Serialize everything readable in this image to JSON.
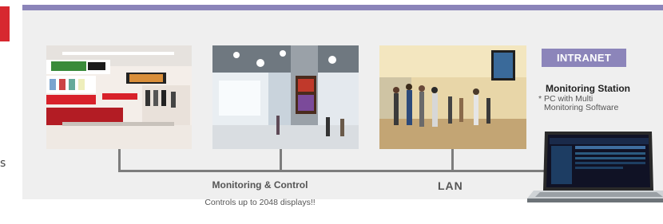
{
  "left_fragment": {
    "text": "s"
  },
  "intranet_label": "INTRANET",
  "monitoring_station": {
    "title": "Monitoring Station",
    "note_line1": "* PC with Multi",
    "note_line2": "Monitoring Software"
  },
  "network": {
    "lan_label": "LAN",
    "control_title": "Monitoring & Control",
    "control_subtitle": "Controls up to 2048 displays!!"
  },
  "colors": {
    "header_bar": "#8b84b9",
    "intranet_badge": "#8c85ba",
    "brand_red": "#d7282f",
    "wire": "#7d7d7d"
  },
  "photos": [
    "retail-store-photo",
    "shopping-mall-photo",
    "office-lobby-photo"
  ]
}
